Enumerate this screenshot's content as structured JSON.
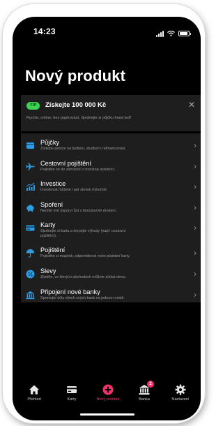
{
  "status": {
    "time": "14:23"
  },
  "page": {
    "title": "Nový produkt"
  },
  "promo": {
    "badge": "TIP",
    "title": "Získejte 100 000 Kč",
    "subtitle": "Rychle, online, bez papírování. Sjednejte si půjčku hned teď!",
    "close_icon": "close-icon"
  },
  "products": [
    {
      "title": "Půjčky",
      "desc": "Získejte peníze na bydlení, studium i refinancování.",
      "icon": "loan-icon"
    },
    {
      "title": "Cestovní pojištění",
      "desc": "Pojistěte se do zahraničí s nonstop asistencí.",
      "icon": "airplane-icon"
    },
    {
      "title": "Investice",
      "desc": "Investovat můžete i pár stovek měsíčně.",
      "icon": "chart-icon"
    },
    {
      "title": "Spoření",
      "desc": "Nechte své úspory růst s bonusovým úrokem.",
      "icon": "piggy-bank-icon"
    },
    {
      "title": "Karty",
      "desc_line1": "Sjednejte si kartu a čerpejte výhody (např. cestovní",
      "desc_line2": "pojištění).",
      "icon": "card-icon"
    },
    {
      "title": "Pojištění",
      "desc": "Pojistěte si majetek, odpovědnost nebo platební karty.",
      "icon": "umbrella-icon"
    },
    {
      "title": "Slevy",
      "desc": "Zjistěte, ve kterých obchodech můžete získat slevu.",
      "icon": "discount-icon"
    },
    {
      "title": "Připojení nové banky",
      "desc": "Spravujte účty všech svých bank na jednom místě.",
      "icon": "bank-icon"
    }
  ],
  "tabs": [
    {
      "label": "Přehled",
      "icon": "home-icon"
    },
    {
      "label": "Karty",
      "icon": "card-icon"
    },
    {
      "label": "Nový produkt",
      "icon": "plus-circle-icon",
      "active": true
    },
    {
      "label": "Banka",
      "icon": "bank-icon",
      "badge": "2"
    },
    {
      "label": "Nastavení",
      "icon": "gear-icon"
    }
  ],
  "colors": {
    "accent": "#f0326b",
    "tip": "#3fd153",
    "card": "#1e1e1e",
    "icon_blue": "#2f9be0",
    "background": "#000000"
  }
}
